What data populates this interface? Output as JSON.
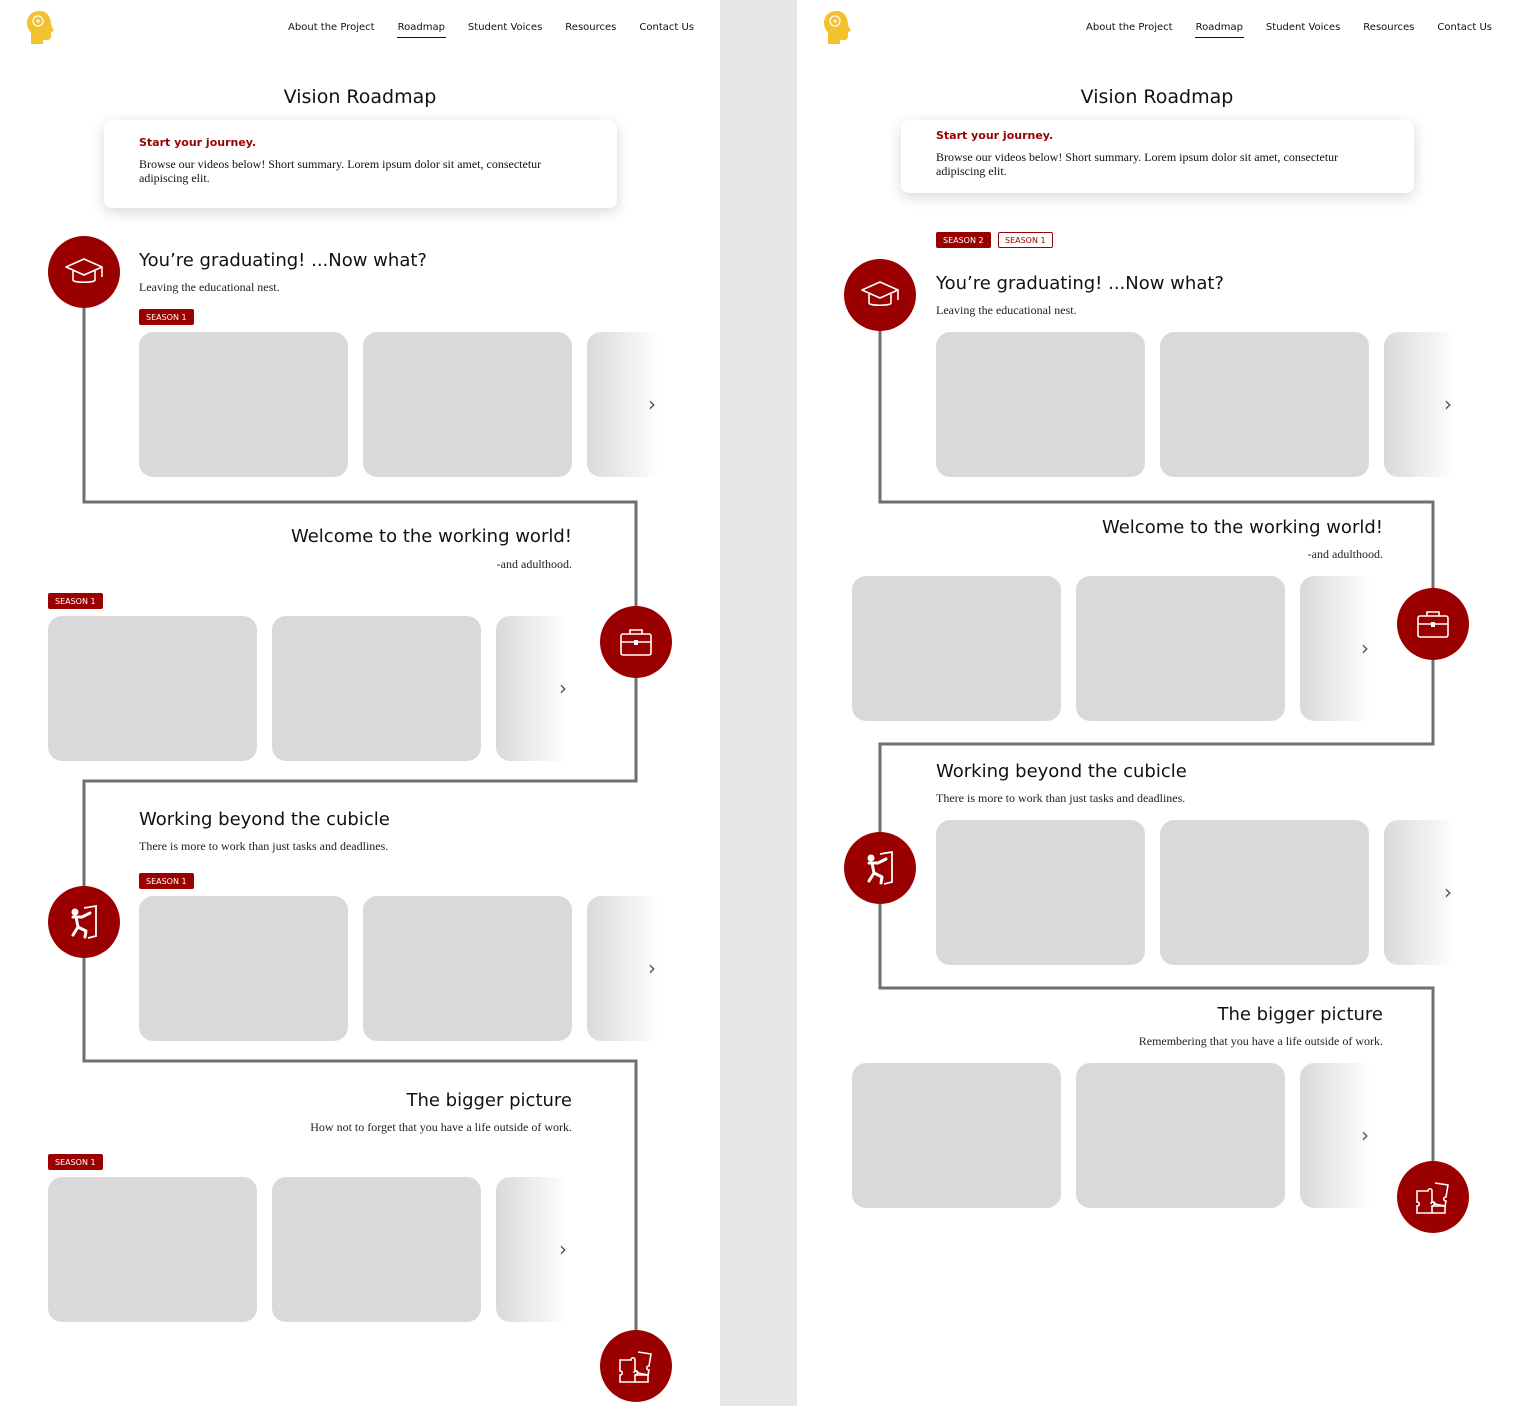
{
  "nav": {
    "items": [
      "About the Project",
      "Roadmap",
      "Student Voices",
      "Resources",
      "Contact Us"
    ],
    "active": "Roadmap"
  },
  "page_title": "Vision Roadmap",
  "intro": {
    "kicker": "Start your journey.",
    "body": "Browse our videos below! Short summary. Lorem ipsum dolor sit amet, consectetur adipiscing elit."
  },
  "badges": {
    "season1": "SEASON 1",
    "season2": "SEASON 2"
  },
  "chevron": "›",
  "left_sections": [
    {
      "title": "You’re graduating! ...Now what?",
      "subtitle": "Leaving the educational nest.",
      "icon": "graduation-cap-icon"
    },
    {
      "title": "Welcome to the working world!",
      "subtitle": "-and adulthood.",
      "icon": "briefcase-icon"
    },
    {
      "title": "Working beyond the cubicle",
      "subtitle": "There is more to work than just tasks and deadlines.",
      "icon": "person-door-icon"
    },
    {
      "title": "The bigger picture",
      "subtitle": "How not to forget that you have a life outside of work.",
      "icon": "puzzle-icon"
    }
  ],
  "right_sections": [
    {
      "title": "You’re graduating! ...Now what?",
      "subtitle": "Leaving the educational nest.",
      "icon": "graduation-cap-icon"
    },
    {
      "title": "Welcome to the working world!",
      "subtitle": "-and adulthood.",
      "icon": "briefcase-icon"
    },
    {
      "title": "Working beyond the cubicle",
      "subtitle": "There is more to work than just tasks and deadlines.",
      "icon": "person-door-icon"
    },
    {
      "title": "The bigger picture",
      "subtitle": "Remembering that you have a life outside of work.",
      "icon": "puzzle-icon"
    }
  ],
  "colors": {
    "accent": "#9b0000",
    "card": "#d9d9d9",
    "path": "#6f6f6f",
    "logo": "#f2c12e"
  }
}
